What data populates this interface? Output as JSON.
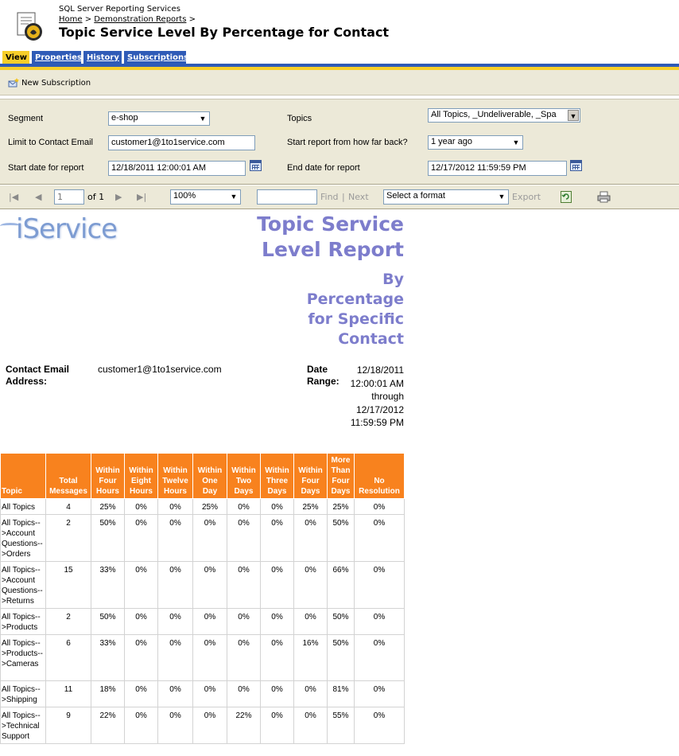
{
  "header": {
    "app_title": "SQL Server Reporting Services",
    "breadcrumb": [
      {
        "label": "Home"
      },
      {
        "label": "Demonstration Reports"
      }
    ],
    "separator": ">",
    "title": "Topic Service Level By Percentage for Contact"
  },
  "tabs": [
    {
      "label": "View",
      "active": true
    },
    {
      "label": "Properties"
    },
    {
      "label": "History"
    },
    {
      "label": "Subscriptions"
    }
  ],
  "subbar": {
    "new_subscription": "New Subscription"
  },
  "params": {
    "segment_label": "Segment",
    "segment_value": "e-shop",
    "topics_label": "Topics",
    "topics_value": "All Topics, _Undeliverable, _Spa",
    "email_label": "Limit to Contact Email",
    "email_value": "customer1@1to1service.com",
    "howfar_label": "Start report from how far back?",
    "howfar_value": "1 year ago",
    "start_label": "Start date for report",
    "start_value": "12/18/2011 12:00:01 AM",
    "end_label": "End date for report",
    "end_value": "12/17/2012 11:59:59 PM"
  },
  "viewer": {
    "page_value": "1",
    "of_label": "of 1",
    "zoom": "100%",
    "find": "Find",
    "next": "Next",
    "sep": "|",
    "format": "Select a format",
    "export": "Export"
  },
  "report": {
    "logo": "iService",
    "title_line1": "Topic Service",
    "title_line2": "Level Report",
    "subtitle": "By Percentage for Specific Contact",
    "contact_label": "Contact Email Address:",
    "contact_value": "customer1@1to1service.com",
    "date_label": "Date Range:",
    "date_value": "12/18/2011 12:00:01 AM through 12/17/2012 11:59:59 PM",
    "columns": [
      "Topic",
      "Total Messages",
      "Within Four Hours",
      "Within Eight Hours",
      "Within Twelve Hours",
      "Within One Day",
      "Within Two Days",
      "Within Three Days",
      "Within Four Days",
      "More Than Four Days",
      "No Resolution"
    ],
    "rows": [
      [
        "All Topics",
        "4",
        "25%",
        "0%",
        "0%",
        "25%",
        "0%",
        "0%",
        "25%",
        "25%",
        "0%"
      ],
      [
        "All Topics-->Account Questions-->Orders",
        "2",
        "50%",
        "0%",
        "0%",
        "0%",
        "0%",
        "0%",
        "0%",
        "50%",
        "0%"
      ],
      [
        "All Topics-->Account Questions-->Returns",
        "15",
        "33%",
        "0%",
        "0%",
        "0%",
        "0%",
        "0%",
        "0%",
        "66%",
        "0%"
      ],
      [
        "All Topics-->Products",
        "2",
        "50%",
        "0%",
        "0%",
        "0%",
        "0%",
        "0%",
        "0%",
        "50%",
        "0%"
      ],
      [
        "All Topics-->Products-->Cameras",
        "6",
        "33%",
        "0%",
        "0%",
        "0%",
        "0%",
        "0%",
        "16%",
        "50%",
        "0%"
      ],
      [
        "All Topics-->Shipping",
        "11",
        "18%",
        "0%",
        "0%",
        "0%",
        "0%",
        "0%",
        "0%",
        "81%",
        "0%"
      ],
      [
        "All Topics-->Technical Support",
        "9",
        "22%",
        "0%",
        "0%",
        "0%",
        "22%",
        "0%",
        "0%",
        "55%",
        "0%"
      ]
    ]
  },
  "colors": {
    "tab_blue": "#2f5bb7",
    "tab_gold": "#f7ce2a",
    "header_orange": "#f8821e",
    "title_purple": "#7d7dcc"
  }
}
